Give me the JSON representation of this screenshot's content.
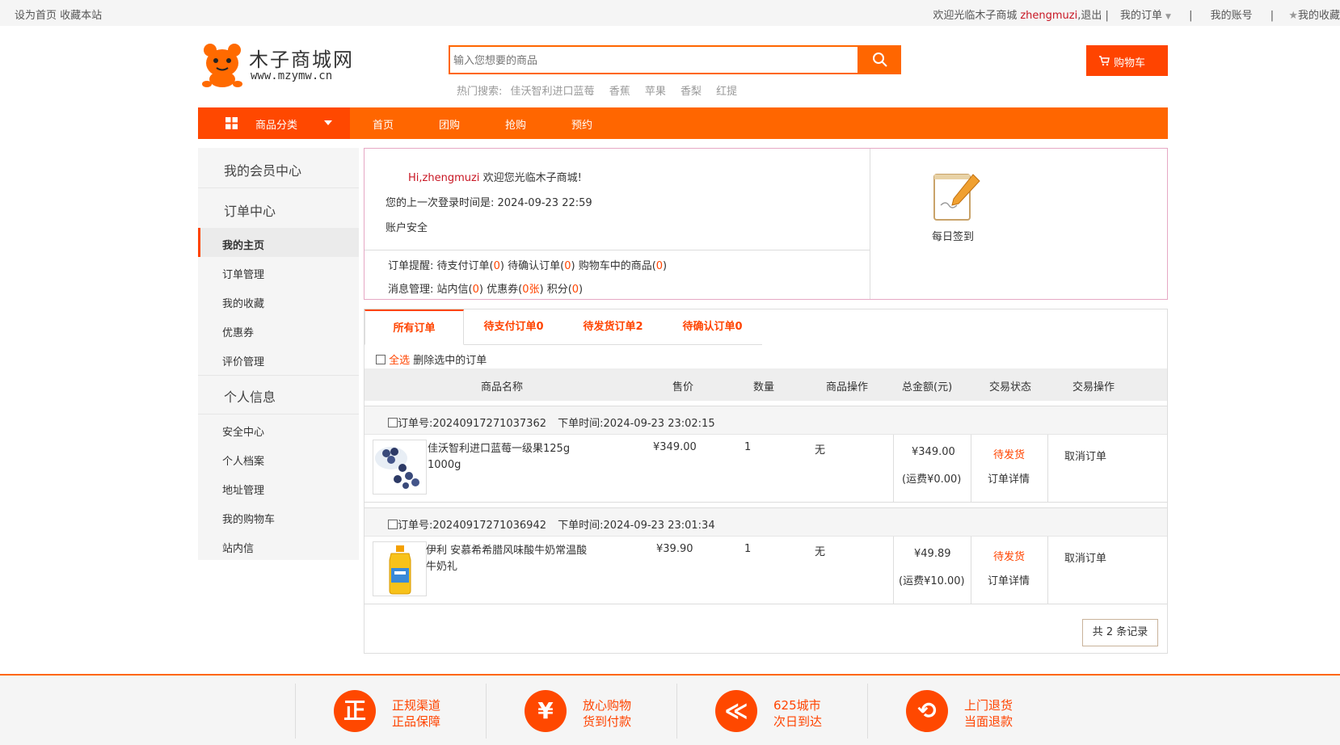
{
  "topbar": {
    "left": "设为首页 收藏本站",
    "welcome": "欢迎光临木子商城",
    "username": "zhengmuzi",
    "logout": ",退出 |",
    "my_orders": "我的订单",
    "sep1": "|",
    "my_account": "我的账号",
    "sep2": "|",
    "my_fav": "我的收藏"
  },
  "header": {
    "logo_title": "木子商城网",
    "logo_sub": "www.mzymw.cn",
    "search_placeholder": "输入您想要的商品",
    "hot_label": "热门搜索:",
    "hot_terms": [
      "佳沃智利进口蓝莓",
      "香蕉",
      "苹果",
      "香梨",
      "红提"
    ],
    "cart_label": "购物车",
    "colors": {
      "accent": "#ff6600",
      "cart": "#ff4400"
    }
  },
  "nav": {
    "category_label": "商品分类",
    "items": [
      "首页",
      "团购",
      "抢购",
      "预约"
    ]
  },
  "sidebar": {
    "member_center": "我的会员中心",
    "order_center": "订单中心",
    "order_items": [
      "我的主页",
      "订单管理",
      "我的收藏",
      "优惠券",
      "评价管理"
    ],
    "personal_info": "个人信息",
    "personal_items": [
      "安全中心",
      "个人档案",
      "地址管理",
      "我的购物车",
      "站内信"
    ]
  },
  "welcome": {
    "hi": "Hi,zhengmuzi",
    "greet": "欢迎您光临木子商城!",
    "last_login_label": "您的上一次登录时间是:",
    "last_login": "2024-09-23 22:59",
    "security": "账户安全",
    "reminder_label": "订单提醒:",
    "pending_pay": "待支付订单(",
    "pending_pay_n": "0",
    "pending_confirm": "待确认订单(",
    "pending_confirm_n": "0",
    "cart_goods": "购物车中的商品(",
    "cart_goods_n": "0",
    "close_paren": ")",
    "msg_label": "消息管理:",
    "inbox": "站内信(",
    "inbox_n": "0",
    "coupons": "优惠券(",
    "coupons_n": "0张",
    "points": "积分(",
    "points_n": "0",
    "signin": "每日签到"
  },
  "orders": {
    "tabs": [
      "所有订单",
      "待支付订单0",
      "待发货订单2",
      "待确认订单0"
    ],
    "select_all": "全选",
    "delete_selected": "删除选中的订单",
    "columns": [
      "商品名称",
      "售价",
      "数量",
      "商品操作",
      "总金额(元)",
      "交易状态",
      "交易操作"
    ],
    "list": [
      {
        "order_no_label": "订单号:",
        "order_no": "20240917271037362",
        "time_label": "下单时间:",
        "time": "2024-09-23 23:02:15",
        "product": "佳沃智利进口蓝莓一级果125g 1000g",
        "price": "¥349.00",
        "qty": "1",
        "op": "无",
        "total": "¥349.00",
        "shipping": "(运费¥0.00)",
        "status": "待发货",
        "detail": "订单详情",
        "action": "取消订单"
      },
      {
        "order_no_label": "订单号:",
        "order_no": "20240917271036942",
        "time_label": "下单时间:",
        "time": "2024-09-23 23:01:34",
        "product": "伊利 安慕希希腊风味酸牛奶常温酸牛奶礼",
        "price": "¥39.90",
        "qty": "1",
        "op": "无",
        "total": "¥49.89",
        "shipping": "(运费¥10.00)",
        "status": "待发货",
        "detail": "订单详情",
        "action": "取消订单"
      }
    ],
    "pager": "共 2 条记录"
  },
  "footer": {
    "items": [
      {
        "icon": "正",
        "l1": "正规渠道",
        "l2": "正品保障"
      },
      {
        "icon": "¥",
        "l1": "放心购物",
        "l2": "货到付款"
      },
      {
        "icon": "≪",
        "l1": "625城市",
        "l2": "次日到达"
      },
      {
        "icon": "⟲",
        "l1": "上门退货",
        "l2": "当面退款"
      }
    ]
  }
}
